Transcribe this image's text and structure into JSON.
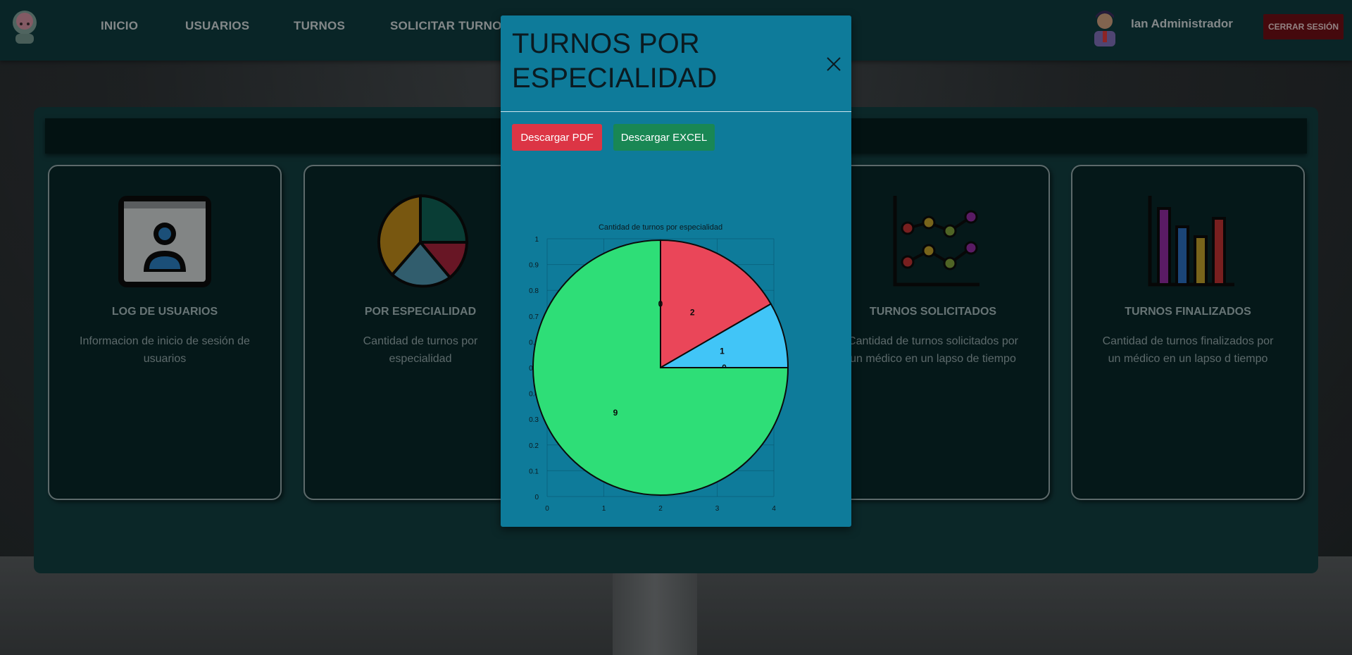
{
  "nav": {
    "links": [
      "INICIO",
      "USUARIOS",
      "TURNOS",
      "SOLICITAR TURNO"
    ],
    "user_name": "Ian Administrador",
    "logout_label": "CERRAR SESIÓN"
  },
  "cards": [
    {
      "title": "LOG DE USUARIOS",
      "desc": "Informacion de inicio de sesión de usuarios"
    },
    {
      "title": "POR ESPECIALIDAD",
      "desc": "Cantidad de turnos por especialidad"
    },
    {
      "title": "TURNOS SOLICITADOS",
      "desc": "Cantidad de turnos solicitados por un médico en un lapso de tiempo"
    },
    {
      "title": "TURNOS FINALIZADOS",
      "desc": "Cantidad de turnos finalizados por un médico en un lapso d tiempo"
    }
  ],
  "modal": {
    "title": "TURNOS POR ESPECIALIDAD",
    "pdf_label": "Descargar PDF",
    "excel_label": "Descargar EXCEL"
  },
  "colors": {
    "navbar": "#0f3a3d",
    "modal": "#0e7b9a",
    "pdf": "#dc3545",
    "excel": "#198754",
    "logout": "#6b0f14"
  },
  "chart_data": {
    "type": "pie",
    "title": "Cantidad de turnos por especialidad",
    "slices": [
      {
        "value": 2,
        "color": "#ea4659"
      },
      {
        "value": 1,
        "color": "#41c5f7"
      },
      {
        "value": 0,
        "color": "#f2c94c"
      },
      {
        "value": 9,
        "color": "#2ede77"
      },
      {
        "value": 0,
        "color": "#c86ad8"
      }
    ],
    "xlim": [
      0,
      4
    ],
    "ylim": [
      0,
      1
    ],
    "x_ticks": [
      "0",
      "1",
      "2",
      "3",
      "4"
    ],
    "y_ticks": [
      "0",
      "0.1",
      "0.2",
      "0.3",
      "0.4",
      "0.5",
      "0.6",
      "0.7",
      "0.8",
      "0.9",
      "1"
    ],
    "grid": true
  }
}
